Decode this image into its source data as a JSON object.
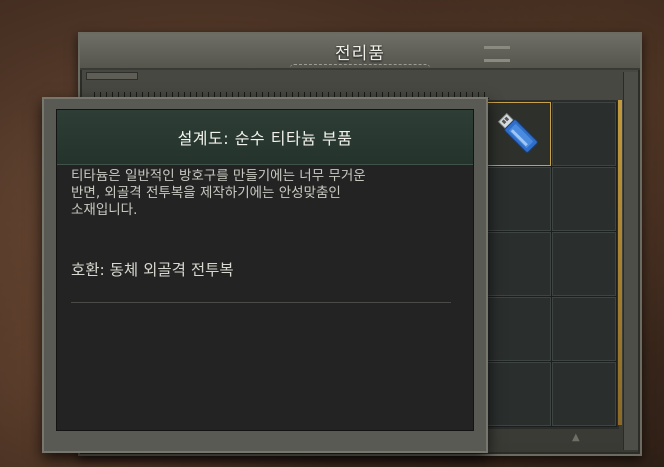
{
  "loot_window": {
    "title": "전리품"
  },
  "inventory": {
    "columns": 2,
    "rows": 5,
    "slots": [
      {
        "item": "titanium-parts-blueprint",
        "icon": "usb-drive-icon",
        "highlighted": true
      },
      {
        "item": null
      },
      {
        "item": null
      },
      {
        "item": null
      },
      {
        "item": null
      },
      {
        "item": null
      },
      {
        "item": null
      },
      {
        "item": null
      },
      {
        "item": null
      },
      {
        "item": null
      }
    ]
  },
  "tooltip": {
    "title": "설계도:  순수 티타늄 부품",
    "description": "티타늄은 일반적인 방호구를 만들기에는 너무 무거운\n반면, 외골격 전투복을 제작하기에는 안성맞춤인\n소재입니다.",
    "compatibility": "호환: 동체 외골격 전투복"
  },
  "colors": {
    "header_green": "#2e3e36",
    "slot_highlight": "#c8a24a",
    "panel_dark": "#232323"
  }
}
